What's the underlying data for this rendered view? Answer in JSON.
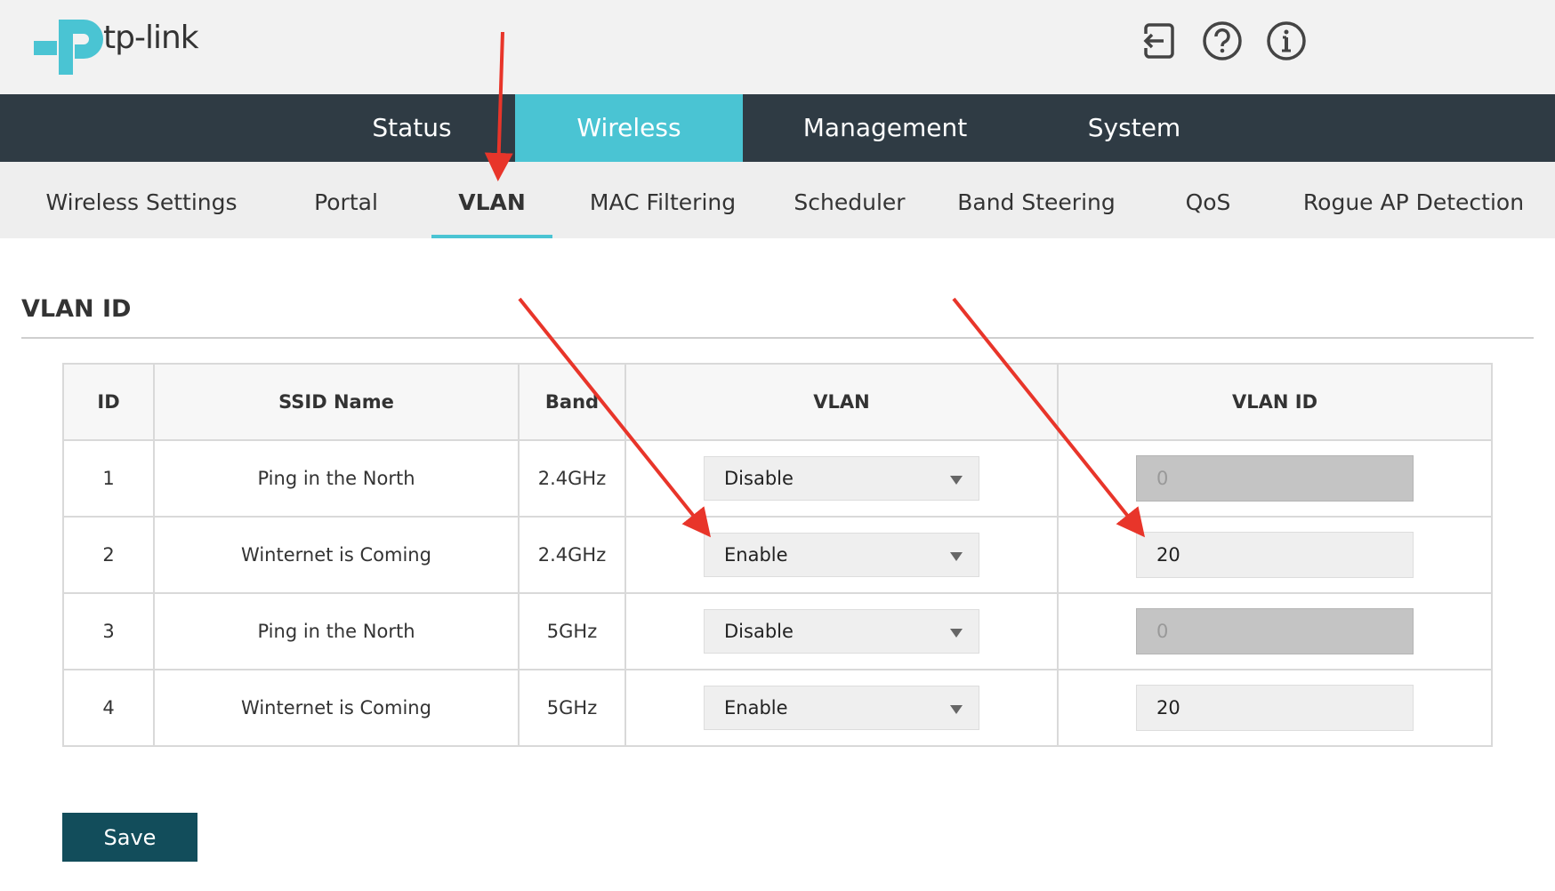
{
  "brand": {
    "name": "tp-link"
  },
  "header": {
    "icons": [
      {
        "name": "logout-icon"
      },
      {
        "name": "help-icon"
      },
      {
        "name": "info-icon"
      }
    ]
  },
  "main_nav": [
    {
      "label": "Status",
      "active": false
    },
    {
      "label": "Wireless",
      "active": true
    },
    {
      "label": "Management",
      "active": false
    },
    {
      "label": "System",
      "active": false
    }
  ],
  "sub_nav": [
    {
      "label": "Wireless Settings",
      "active": false
    },
    {
      "label": "Portal",
      "active": false
    },
    {
      "label": "VLAN",
      "active": true
    },
    {
      "label": "MAC Filtering",
      "active": false
    },
    {
      "label": "Scheduler",
      "active": false
    },
    {
      "label": "Band Steering",
      "active": false
    },
    {
      "label": "QoS",
      "active": false
    },
    {
      "label": "Rogue AP Detection",
      "active": false
    }
  ],
  "section": {
    "title": "VLAN ID"
  },
  "table": {
    "headers": [
      "ID",
      "SSID Name",
      "Band",
      "VLAN",
      "VLAN ID"
    ],
    "rows": [
      {
        "id": "1",
        "ssid": "Ping in the North",
        "band": "2.4GHz",
        "vlan": "Disable",
        "vlan_id": "0",
        "vlan_id_disabled": true
      },
      {
        "id": "2",
        "ssid": "Winternet is Coming",
        "band": "2.4GHz",
        "vlan": "Enable",
        "vlan_id": "20",
        "vlan_id_disabled": false
      },
      {
        "id": "3",
        "ssid": "Ping in the North",
        "band": "5GHz",
        "vlan": "Disable",
        "vlan_id": "0",
        "vlan_id_disabled": true
      },
      {
        "id": "4",
        "ssid": "Winternet is Coming",
        "band": "5GHz",
        "vlan": "Enable",
        "vlan_id": "20",
        "vlan_id_disabled": false
      }
    ]
  },
  "actions": {
    "save_label": "Save"
  },
  "colors": {
    "accent": "#4ac4d3",
    "nav_bg": "#2f3b44",
    "save_button": "#124d5b",
    "annotation_arrow": "#e8352a"
  }
}
